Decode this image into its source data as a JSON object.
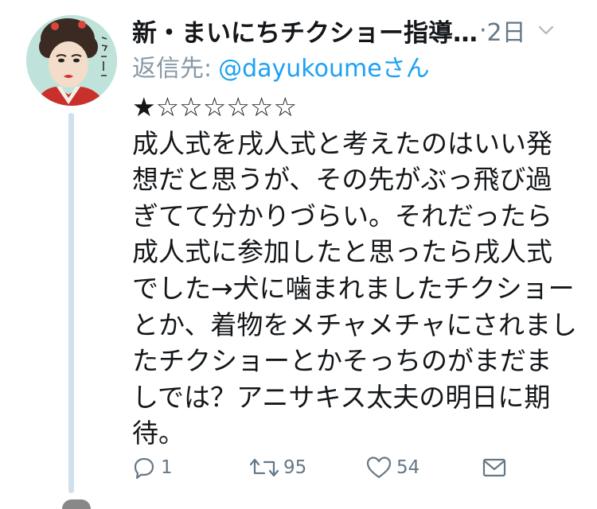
{
  "tweet": {
    "display_name": "新・まいにちチクショー指導…",
    "separator": "·",
    "time": "2日",
    "reply_prefix": "返信先:",
    "reply_handle": "@dayukoumeさん",
    "text": "★☆☆☆☆☆☆\n成人式を戌人式と考えたのはいい発想だと思うが、その先がぶっ飛び過ぎてて分かりづらい。それだったら成人式に参加したと思ったら戌人式でした→犬に噛まれましたチクショーとか、着物をメチャメチャにされましたチクショーとかそっちのがまだましでは？アニサキス太夫の明日に期待。",
    "avatar_caption": "チクショー",
    "actions": {
      "reply_count": "1",
      "retweet_count": "95",
      "like_count": "54"
    }
  },
  "icons": [
    "avatar",
    "caret-down-icon",
    "reply-icon",
    "retweet-icon",
    "like-icon",
    "message-icon"
  ],
  "colors": {
    "text": "#14171a",
    "muted": "#657786",
    "link": "#1da1f2",
    "thread_line": "#cfe0ec"
  }
}
